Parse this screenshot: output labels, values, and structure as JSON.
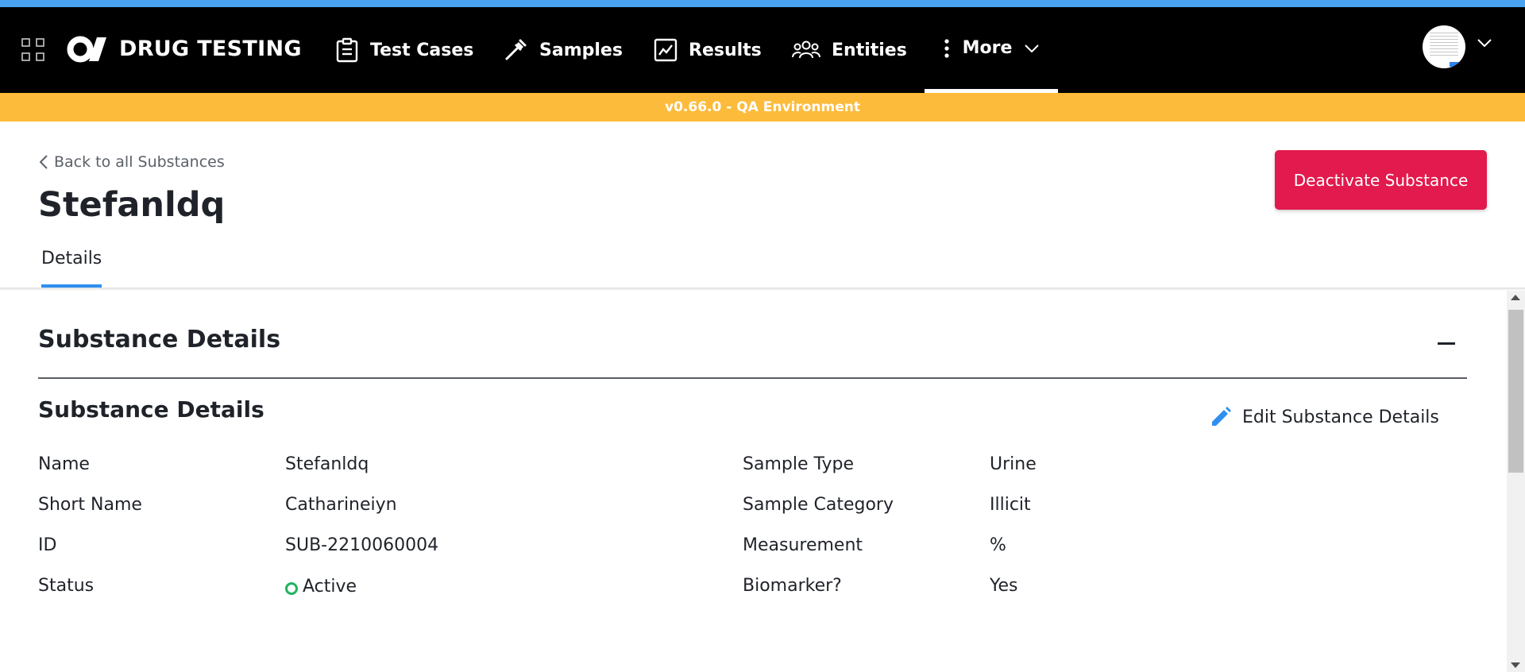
{
  "header": {
    "brand": "DRUG TESTING",
    "nav": [
      {
        "label": "Test Cases",
        "icon": "clipboard-icon"
      },
      {
        "label": "Samples",
        "icon": "pipette-icon"
      },
      {
        "label": "Results",
        "icon": "chart-line-icon"
      },
      {
        "label": "Entities",
        "icon": "people-icon"
      },
      {
        "label": "More",
        "icon": "kebab-icon",
        "active": true
      }
    ]
  },
  "banner": {
    "text": "v0.66.0 - QA Environment"
  },
  "page": {
    "back_label": "Back to all Substances",
    "title": "Stefanldq",
    "deactivate_label": "Deactivate Substance",
    "tabs": [
      {
        "label": "Details",
        "active": true
      }
    ]
  },
  "section": {
    "title": "Substance Details",
    "subsection_title": "Substance Details",
    "edit_label": "Edit Substance Details"
  },
  "fields_left": [
    {
      "label": "Name",
      "value": "Stefanldq"
    },
    {
      "label": "Short Name",
      "value": "Catharineiyn"
    },
    {
      "label": "ID",
      "value": "SUB-2210060004"
    },
    {
      "label": "Status",
      "value": "Active"
    }
  ],
  "fields_right": [
    {
      "label": "Sample Type",
      "value": "Urine"
    },
    {
      "label": "Sample Category",
      "value": "Illicit"
    },
    {
      "label": "Measurement",
      "value": "%"
    },
    {
      "label": "Biomarker?",
      "value": "Yes"
    }
  ],
  "colors": {
    "top_strip": "#4aa3f0",
    "navbar": "#000000",
    "banner": "#fdbb3b",
    "danger": "#e21a4d",
    "accent": "#2f8ff0",
    "status_active": "#20b462"
  }
}
